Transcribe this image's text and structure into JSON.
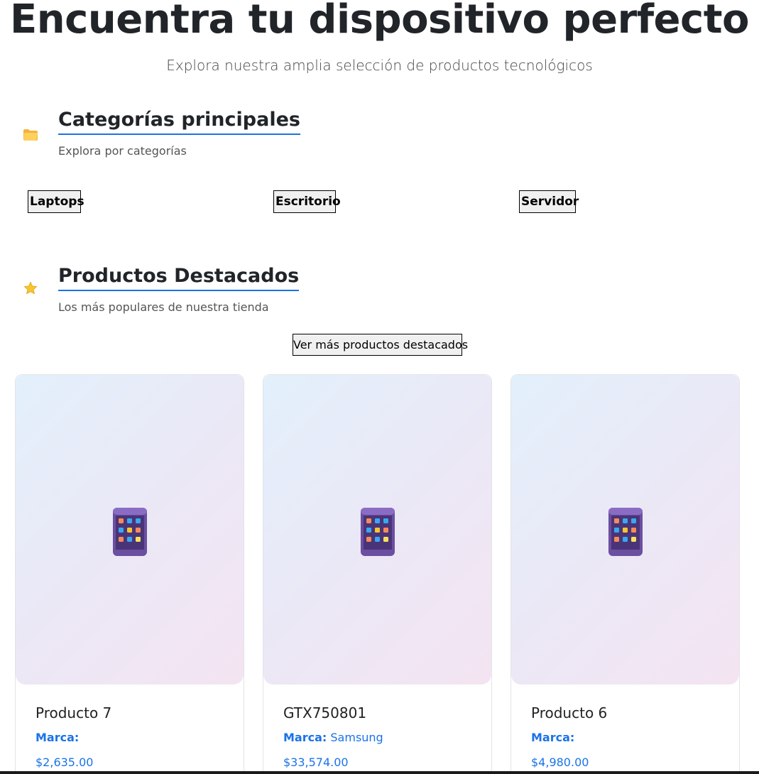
{
  "hero": {
    "title": "Encuentra tu dispositivo perfecto",
    "subtitle": "Explora nuestra amplia selección de productos tecnológicos"
  },
  "categories_section": {
    "icon": "folder-icon",
    "title": "Categorías principales",
    "subtitle": "Explora por categorías",
    "buttons": [
      "Laptops",
      "Escritorio",
      "Servidor"
    ]
  },
  "featured_section": {
    "icon": "star-icon",
    "title": "Productos Destacados",
    "subtitle": "Los más populares de nuestra tienda",
    "more_button": "Ver más productos destacados"
  },
  "products": [
    {
      "name": "Producto 7",
      "brand_label": "Marca:",
      "brand": "",
      "price": "$2,635.00",
      "icon": "tablet-apps-icon"
    },
    {
      "name": "GTX750801",
      "brand_label": "Marca:",
      "brand": "Samsung",
      "price": "$33,574.00",
      "icon": "tablet-apps-icon"
    },
    {
      "name": "Producto 6",
      "brand_label": "Marca:",
      "brand": "",
      "price": "$4,980.00",
      "icon": "tablet-apps-icon"
    }
  ],
  "colors": {
    "accent": "#1a73e8",
    "text": "#212529",
    "card_gradient_start": "#e2f0fb",
    "card_gradient_end": "#f4e4f2"
  }
}
